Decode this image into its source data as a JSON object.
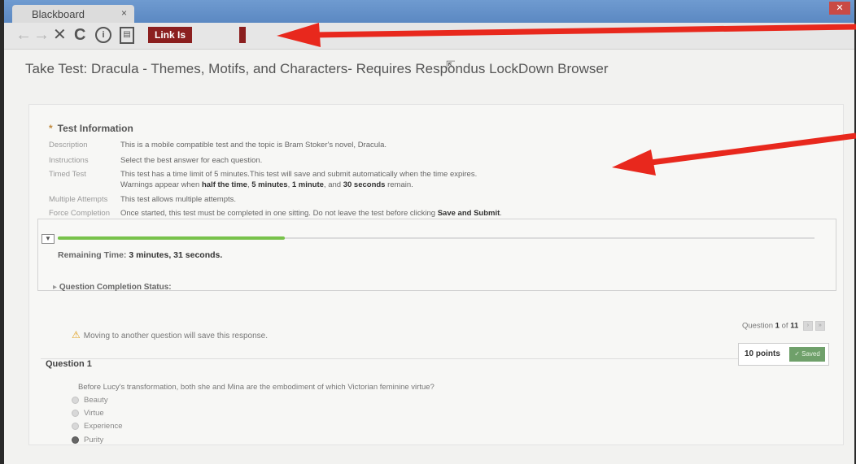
{
  "browser": {
    "tab_title": "Blackboard",
    "tab_close": "×",
    "link_label": "Link Is",
    "close_glyph": "✕",
    "nav": {
      "back": "←",
      "forward": "→",
      "stop": "✕",
      "reload": "C"
    }
  },
  "page": {
    "title": "Take Test: Dracula - Themes, Motifs, and Characters- Requires Respondus LockDown Browser"
  },
  "test_info": {
    "heading": "Test Information",
    "rows": [
      {
        "label": "Description",
        "text": "This is a mobile compatible test and the topic is Bram Stoker's novel, Dracula."
      },
      {
        "label": "Instructions",
        "text": "Select the best answer for each question."
      },
      {
        "label": "Timed Test",
        "text": "This test has a time limit of 5 minutes.This test will save and submit automatically when the time expires."
      },
      {
        "label": "Multiple Attempts",
        "text": "This test allows multiple attempts."
      },
      {
        "label": "Force Completion",
        "text_pre": "Once started, this test must be completed in one sitting. Do not leave the test before clicking",
        "text_bold": "Save and Submit"
      }
    ],
    "warnings": {
      "pre": "Warnings appear when",
      "b1": "half the time",
      "b2": "5 minutes",
      "b3": "1 minute",
      "mid": "and",
      "b4": "30 seconds",
      "post": "remain."
    }
  },
  "timer": {
    "progress_fraction": 0.3,
    "label": "Remaining Time:",
    "value": "3 minutes, 31 seconds.",
    "completion_status": "Question Completion Status:"
  },
  "question": {
    "pager_pre": "Question",
    "number": "1",
    "pager_mid": "of",
    "total": "11",
    "warning": "Moving to another question will save this response.",
    "title": "Question 1",
    "points": "10 points",
    "saved": "Saved",
    "text": "Before Lucy's transformation, both she and Mina are the embodiment of which Victorian feminine virtue?",
    "options": [
      "Beauty",
      "Virtue",
      "Experience",
      "Purity"
    ],
    "selected_index": 3
  },
  "colors": {
    "annotation_arrow": "#e8281d",
    "progress": "#78c24a",
    "saved_badge": "#6fa06a",
    "link_button": "#8b1f1f"
  }
}
